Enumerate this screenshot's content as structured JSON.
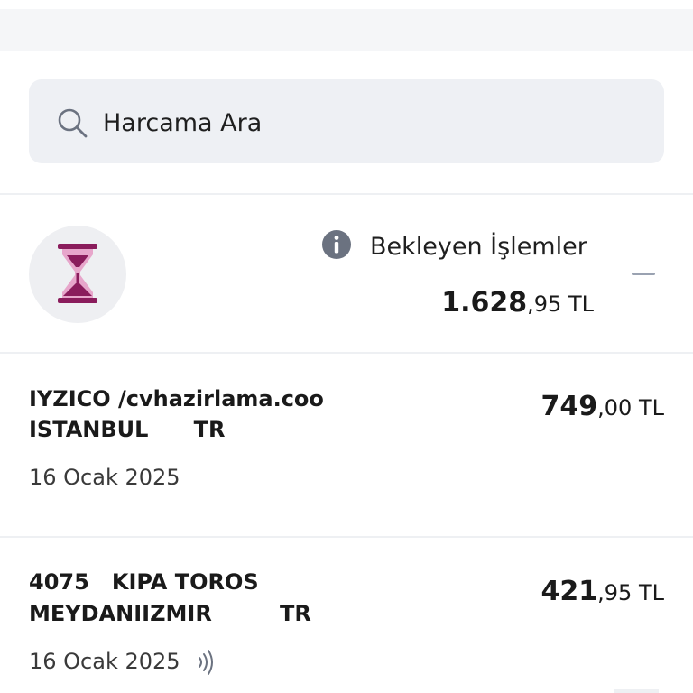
{
  "search": {
    "placeholder": "Harcama Ara"
  },
  "pending": {
    "label": "Bekleyen İşlemler",
    "amount_int": "1.628",
    "amount_dec": ",95",
    "currency": " TL"
  },
  "transactions": [
    {
      "merchant_line1": "IYZICO /cvhazirlama.coo",
      "merchant_line2": "ISTANBUL      TR",
      "date": "16 Ocak 2025",
      "amount_int": "749",
      "amount_dec": ",00",
      "currency": " TL",
      "contactless": false
    },
    {
      "merchant_line1": "4075   KIPA TOROS",
      "merchant_line2": "MEYDANIIZMIR         TR",
      "date": "16 Ocak 2025",
      "amount_int": "421",
      "amount_dec": ",95",
      "currency": " TL",
      "contactless": true
    }
  ],
  "colors": {
    "brand": "#8a1c5c",
    "brand_light": "#e7a6cb",
    "search_bg": "#eef0f4",
    "icon_gray": "#6b7280"
  },
  "icons": {
    "search": "search-icon",
    "pending": "hourglass-icon",
    "info": "info-icon",
    "collapse": "minus-icon",
    "contactless": "contactless-icon"
  }
}
